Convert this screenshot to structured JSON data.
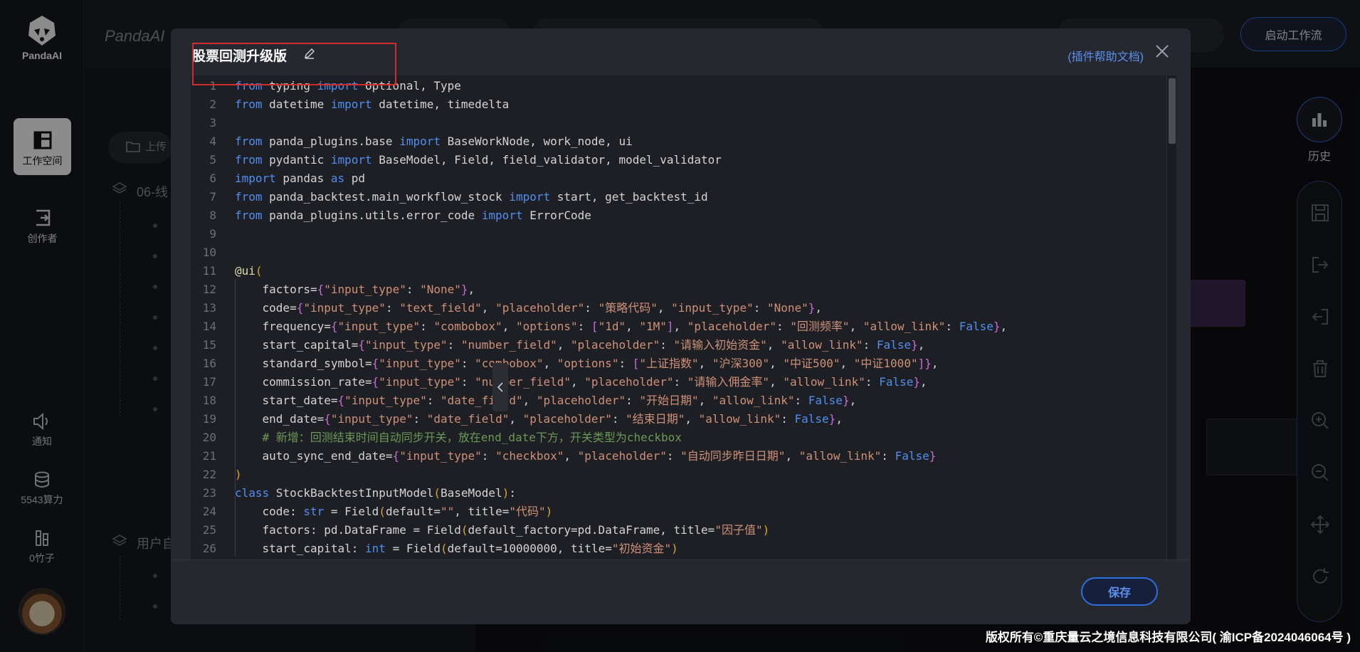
{
  "app": {
    "logo_text": "PandaAI",
    "brand": "PandaAI"
  },
  "topbar": {
    "start_workflow_label": "启动工作流"
  },
  "nav": {
    "workspace_label": "工作空间",
    "creator_label": "创作者",
    "notify_label": "通知",
    "compute_label": "5543算力",
    "bamboo_label": "0竹子"
  },
  "sidebar": {
    "upload_label": "上传",
    "group1_label": "06-线",
    "group2_label": "用户自"
  },
  "toolbar": {
    "history_label": "历史"
  },
  "footer": {
    "copyright": "版权所有©重庆量云之境信息科技有限公司( 渝ICP备2024046064号 )"
  },
  "modal": {
    "title": "股票回测升级版",
    "help_link": "(插件帮助文档)",
    "save_label": "保存",
    "code_lines": [
      {
        "n": "1",
        "t": "from typing import Optional, Type"
      },
      {
        "n": "2",
        "t": "from datetime import datetime, timedelta"
      },
      {
        "n": "3",
        "t": ""
      },
      {
        "n": "4",
        "t": "from panda_plugins.base import BaseWorkNode, work_node, ui"
      },
      {
        "n": "5",
        "t": "from pydantic import BaseModel, Field, field_validator, model_validator"
      },
      {
        "n": "6",
        "t": "import pandas as pd"
      },
      {
        "n": "7",
        "t": "from panda_backtest.main_workflow_stock import start, get_backtest_id"
      },
      {
        "n": "8",
        "t": "from panda_plugins.utils.error_code import ErrorCode"
      },
      {
        "n": "9",
        "t": ""
      },
      {
        "n": "10",
        "t": ""
      },
      {
        "n": "11",
        "t": "@ui("
      },
      {
        "n": "12",
        "t": "    factors={\"input_type\": \"None\"},"
      },
      {
        "n": "13",
        "t": "    code={\"input_type\": \"text_field\", \"placeholder\": \"策略代码\", \"input_type\": \"None\"},"
      },
      {
        "n": "14",
        "t": "    frequency={\"input_type\": \"combobox\", \"options\": [\"1d\", \"1M\"], \"placeholder\": \"回测频率\", \"allow_link\": False},"
      },
      {
        "n": "15",
        "t": "    start_capital={\"input_type\": \"number_field\", \"placeholder\": \"请输入初始资金\", \"allow_link\": False},"
      },
      {
        "n": "16",
        "t": "    standard_symbol={\"input_type\": \"combobox\", \"options\": [\"上证指数\", \"沪深300\", \"中证500\", \"中证1000\"]},"
      },
      {
        "n": "17",
        "t": "    commission_rate={\"input_type\": \"number_field\", \"placeholder\": \"请输入佣金率\", \"allow_link\": False},"
      },
      {
        "n": "18",
        "t": "    start_date={\"input_type\": \"date_field\", \"placeholder\": \"开始日期\", \"allow_link\": False},"
      },
      {
        "n": "19",
        "t": "    end_date={\"input_type\": \"date_field\", \"placeholder\": \"结束日期\", \"allow_link\": False},"
      },
      {
        "n": "20",
        "t": "    # 新增：回测结束时间自动同步开关，放在end_date下方，开关类型为checkbox"
      },
      {
        "n": "21",
        "t": "    auto_sync_end_date={\"input_type\": \"checkbox\", \"placeholder\": \"自动同步昨日日期\", \"allow_link\": False}"
      },
      {
        "n": "22",
        "t": ")"
      },
      {
        "n": "23",
        "t": "class StockBacktestInputModel(BaseModel):"
      },
      {
        "n": "24",
        "t": "    code: str = Field(default=\"\", title=\"代码\")"
      },
      {
        "n": "25",
        "t": "    factors: pd.DataFrame = Field(default_factory=pd.DataFrame, title=\"因子值\")"
      },
      {
        "n": "26",
        "t": "    start_capital: int = Field(default=10000000, title=\"初始资金\")"
      }
    ]
  },
  "colors": {
    "accent": "#2f6ee0",
    "link": "#5b8ff0",
    "highlight": "#d22b2b",
    "keyword": "#4f8ff0",
    "string": "#ce9178",
    "comment": "#6a9955"
  },
  "icons": [
    "panda-logo-icon",
    "workspace-icon",
    "creator-icon",
    "notify-icon",
    "database-icon",
    "bamboo-icon",
    "edit-icon",
    "close-icon",
    "history-chart-icon",
    "save-icon",
    "export-icon",
    "import-icon",
    "trash-icon",
    "zoom-in-icon",
    "zoom-out-icon",
    "move-icon",
    "refresh-icon",
    "chevron-left-icon",
    "folder-icon",
    "layers-icon"
  ]
}
